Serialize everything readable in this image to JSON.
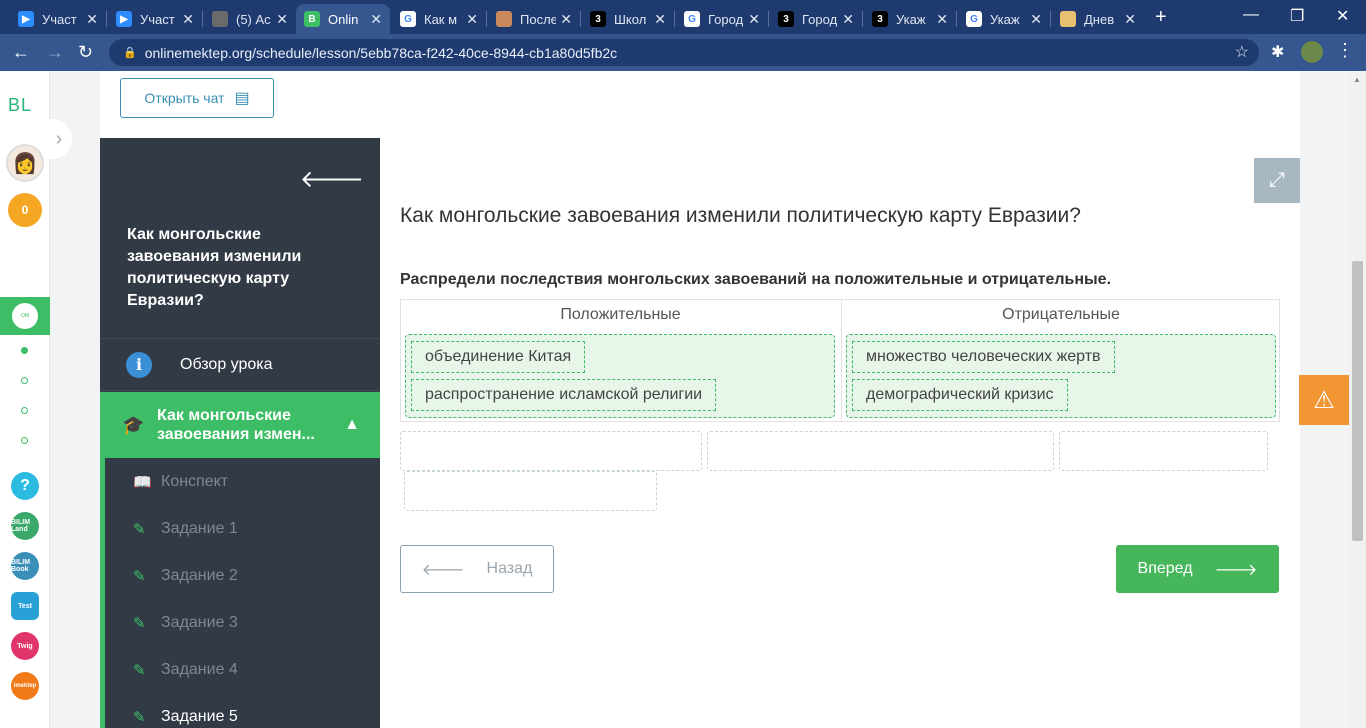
{
  "browser": {
    "tabs": [
      {
        "title": "Участ",
        "favicon": "zoom-icon",
        "color": "#2d8cff"
      },
      {
        "title": "Участ",
        "favicon": "zoom-icon",
        "color": "#2d8cff"
      },
      {
        "title": "(5) Ас",
        "favicon": "generic-icon",
        "color": "#6b6b6b"
      },
      {
        "title": "Onlin",
        "favicon": "onlinemektep-icon",
        "color": "#3dbe66"
      },
      {
        "title": "Как м",
        "favicon": "google-icon",
        "color": "#ffffff"
      },
      {
        "title": "После",
        "favicon": "image-icon",
        "color": "#c88a5a"
      },
      {
        "title": "Школ",
        "favicon": "znanija-icon",
        "color": "#000000"
      },
      {
        "title": "Город",
        "favicon": "google-icon",
        "color": "#ffffff"
      },
      {
        "title": "Город",
        "favicon": "znanija-icon",
        "color": "#000000"
      },
      {
        "title": "Укаж",
        "favicon": "znanija-icon",
        "color": "#000000"
      },
      {
        "title": "Укаж",
        "favicon": "google-icon",
        "color": "#ffffff"
      },
      {
        "title": "Днев",
        "favicon": "diary-icon",
        "color": "#e8c170"
      }
    ],
    "url": "onlinemektep.org/schedule/lesson/5ebb78ca-f242-40ce-8944-cb1a80d5fb2c"
  },
  "rail": {
    "logo": "BL",
    "coins": "0",
    "apps": [
      {
        "name": "help-app",
        "label": "?",
        "color": "#2bbbe0"
      },
      {
        "name": "bilimland-app",
        "label": "BILIM Land",
        "color": "#3aa86b"
      },
      {
        "name": "bilimbook-app",
        "label": "BILIM Book",
        "color": "#3a8fb7"
      },
      {
        "name": "test-app",
        "label": "Test",
        "color": "#2aa1d6"
      },
      {
        "name": "twig-app",
        "label": "Twig",
        "color": "#e0356b"
      },
      {
        "name": "imektep-app",
        "label": "imektep",
        "color": "#f07a1a"
      }
    ]
  },
  "content": {
    "chat_button": "Открыть чат",
    "lesson_title": "Как монгольские завоевания изменили политическую карту Евразии?",
    "overview": "Обзор урока",
    "active_section": "Как монгольские завоевания измен...",
    "subitems": [
      "Конспект",
      "Задание 1",
      "Задание 2",
      "Задание 3",
      "Задание 4",
      "Задание 5"
    ],
    "question_title": "Как монгольские завоевания изменили политическую карту Евразии?",
    "instruction": "Распредели последствия монгольских завоеваний на положительные и отрицательные.",
    "columns": {
      "positive": {
        "header": "Положительные",
        "items": [
          "объединение Китая",
          "распространение исламской религии"
        ]
      },
      "negative": {
        "header": "Отрицательные",
        "items": [
          "множество человеческих жертв",
          "демографический кризис"
        ]
      }
    },
    "back_button": "Назад",
    "next_button": "Вперед"
  },
  "colors": {
    "accent": "#3dbe66",
    "panel": "#323a45",
    "link": "#3a8fb7",
    "warning": "#f29633"
  }
}
